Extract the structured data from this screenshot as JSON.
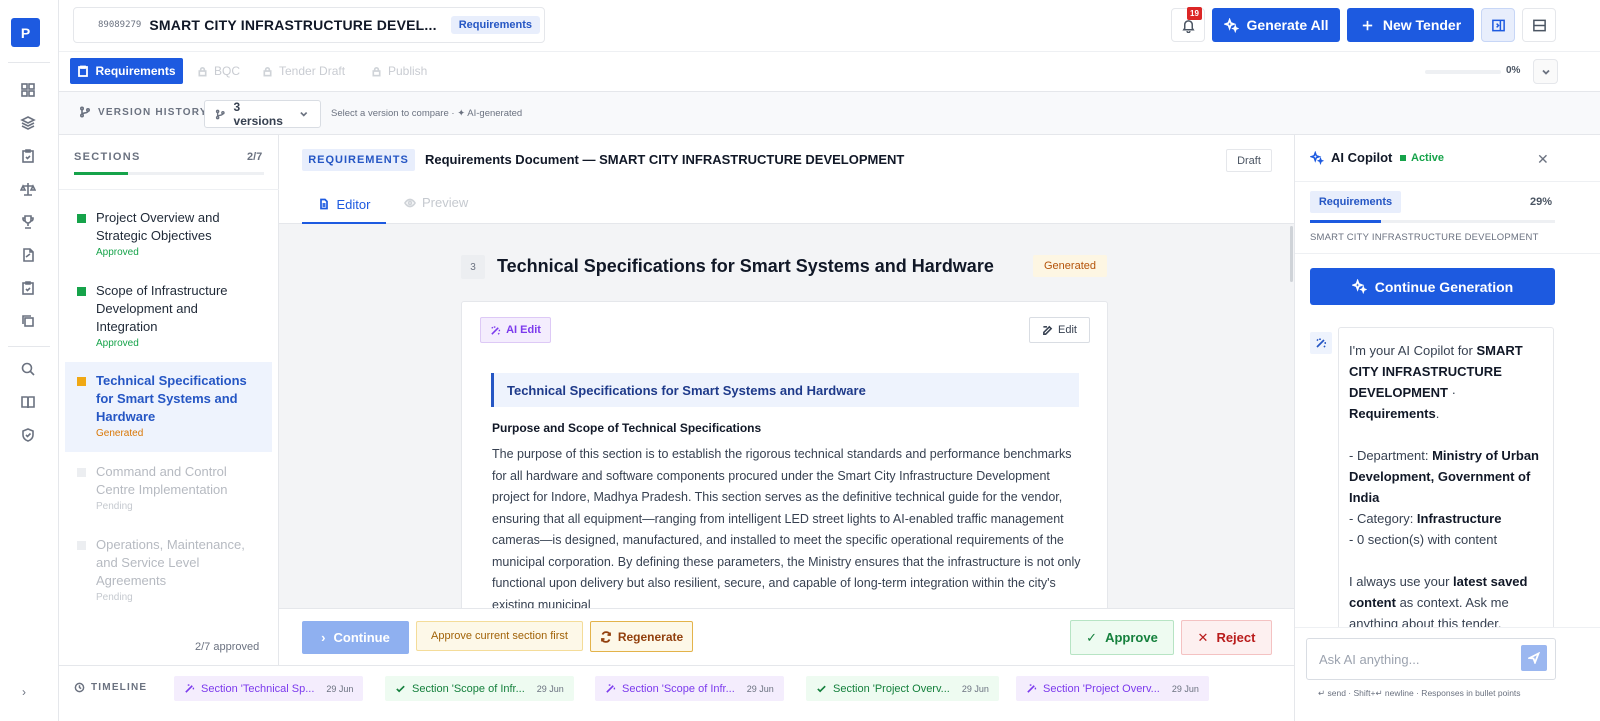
{
  "app": {
    "logo_letter": "P"
  },
  "project": {
    "id": "89089279",
    "title": "SMART CITY INFRASTRUCTURE DEVEL...",
    "stage_pill": "Requirements"
  },
  "header": {
    "notification_count": "19",
    "generate_all_label": "Generate All",
    "new_tender_label": "New Tender"
  },
  "stages": {
    "active": "Requirements",
    "locked": [
      "BQC",
      "Tender Draft",
      "Publish"
    ],
    "progress_label": "0%",
    "progress_value": 0
  },
  "version_history": {
    "label": "VERSION HISTORY",
    "selected": "3 versions",
    "hint": "Select a version to compare · ✦ AI-generated"
  },
  "sections_panel": {
    "heading": "SECTIONS",
    "count": "2/7",
    "progress_fraction": 0.2857,
    "footer": "2/7 approved",
    "items": [
      {
        "title": "Project Overview and Strategic Objectives",
        "status": "Approved",
        "kind": "approved"
      },
      {
        "title": "Scope of Infrastructure Development and Integration",
        "status": "Approved",
        "kind": "approved"
      },
      {
        "title": "Technical Specifications for Smart Systems and Hardware",
        "status": "Generated",
        "kind": "generated"
      },
      {
        "title": "Command and Control Centre Implementation",
        "status": "Pending",
        "kind": "pending"
      },
      {
        "title": "Operations, Maintenance, and Service Level Agreements",
        "status": "Pending",
        "kind": "pending"
      }
    ]
  },
  "document": {
    "type_pill": "REQUIREMENTS",
    "title": "Requirements Document — SMART CITY INFRASTRUCTURE DEVELOPMENT",
    "status_badge": "Draft",
    "tabs": {
      "editor": "Editor",
      "preview": "Preview"
    },
    "section_number": "3",
    "section_title": "Technical Specifications for Smart Systems and Hardware",
    "section_badge": "Generated",
    "ai_edit_label": "AI Edit",
    "edit_label": "Edit",
    "callout_title": "Technical Specifications for Smart Systems and Hardware",
    "sub_heading": "Purpose and Scope of Technical Specifications",
    "body": "The purpose of this section is to establish the rigorous technical standards and performance benchmarks for all hardware and software components procured under the Smart City Infrastructure Development project for Indore, Madhya Pradesh. This section serves as the definitive technical guide for the vendor, ensuring that all equipment—ranging from intelligent LED street lights to AI-enabled traffic management cameras—is designed, manufactured, and installed to meet the specific operational requirements of the municipal corporation. By defining these parameters, the Ministry ensures that the infrastructure is not only functional upon delivery but also resilient, secure, and capable of long-term integration within the city's existing municipal"
  },
  "actions": {
    "continue_label": "Continue",
    "approve_first_label": "Approve current section first",
    "regenerate_label": "Regenerate",
    "approve_label": "Approve",
    "reject_label": "Reject"
  },
  "copilot": {
    "title": "AI Copilot",
    "status": "Active",
    "stage_pill": "Requirements",
    "progress_label": "29%",
    "progress_fraction": 0.29,
    "subtitle": "SMART CITY INFRASTRUCTURE DEVELOPMENT",
    "continue_label": "Continue Generation",
    "message": {
      "intro": "I'm your AI Copilot for ",
      "project": "SMART CITY INFRASTRUCTURE DEVELOPMENT",
      "sep": " · ",
      "stage": "Requirements",
      "dept_label": "- Department: ",
      "dept": "Ministry of Urban Development, Government of India",
      "cat_label": "- Category: ",
      "cat": "Infrastructure",
      "sections_line": "- 0 section(s) with content",
      "ctx1": "I always use your ",
      "ctx_bold": "latest saved content",
      "ctx2": " as context. Ask me anything about this tender."
    },
    "input_placeholder": "Ask AI anything...",
    "hint": "↵ send · Shift+↵ newline · Responses in bullet points"
  },
  "timeline": {
    "label": "TIMELINE",
    "events": [
      {
        "text": "Section 'Technical Sp...",
        "date": "29 Jun",
        "kind": "purple"
      },
      {
        "text": "Section 'Scope of Infr...",
        "date": "29 Jun",
        "kind": "green"
      },
      {
        "text": "Section 'Scope of Infr...",
        "date": "29 Jun",
        "kind": "purple"
      },
      {
        "text": "Section 'Project Overv...",
        "date": "29 Jun",
        "kind": "green"
      },
      {
        "text": "Section 'Project Overv...",
        "date": "29 Jun",
        "kind": "purple"
      }
    ]
  },
  "colors": {
    "primary": "#1d5ae0",
    "approved": "#16a34a",
    "generated": "#f0a814",
    "pending": "#e5e7eb",
    "ai_purple": "#7c3aed"
  }
}
